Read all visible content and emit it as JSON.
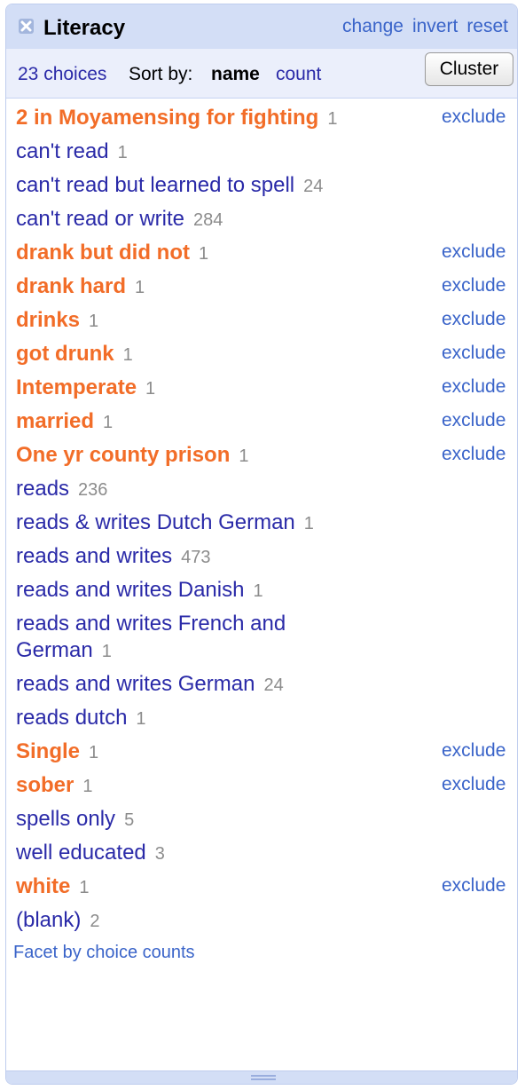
{
  "facet": {
    "title": "Literacy",
    "change": "change",
    "invert": "invert",
    "reset": "reset",
    "choice_count": "23 choices",
    "sort_by": "Sort by:",
    "sort_name": "name",
    "sort_count": "count",
    "cluster": "Cluster",
    "exclude": "exclude",
    "footer_link": "Facet by choice counts"
  },
  "choices": [
    {
      "label": "2 in Moyamensing for fighting",
      "count": "1",
      "selected": true
    },
    {
      "label": "can't read",
      "count": "1",
      "selected": false
    },
    {
      "label": "can't read but learned to spell",
      "count": "24",
      "selected": false
    },
    {
      "label": "can't read or write",
      "count": "284",
      "selected": false
    },
    {
      "label": "drank but did not",
      "count": "1",
      "selected": true
    },
    {
      "label": "drank hard",
      "count": "1",
      "selected": true
    },
    {
      "label": "drinks",
      "count": "1",
      "selected": true
    },
    {
      "label": "got drunk",
      "count": "1",
      "selected": true
    },
    {
      "label": "Intemperate",
      "count": "1",
      "selected": true
    },
    {
      "label": "married",
      "count": "1",
      "selected": true
    },
    {
      "label": "One yr county prison",
      "count": "1",
      "selected": true
    },
    {
      "label": "reads",
      "count": "236",
      "selected": false
    },
    {
      "label": "reads & writes Dutch German",
      "count": "1",
      "selected": false
    },
    {
      "label": "reads and writes",
      "count": "473",
      "selected": false
    },
    {
      "label": "reads and writes Danish",
      "count": "1",
      "selected": false
    },
    {
      "label": "reads and writes French and German",
      "count": "1",
      "selected": false
    },
    {
      "label": "reads and writes German",
      "count": "24",
      "selected": false
    },
    {
      "label": "reads dutch",
      "count": "1",
      "selected": false
    },
    {
      "label": "Single",
      "count": "1",
      "selected": true
    },
    {
      "label": "sober",
      "count": "1",
      "selected": true
    },
    {
      "label": "spells only",
      "count": "5",
      "selected": false
    },
    {
      "label": "well educated",
      "count": "3",
      "selected": false
    },
    {
      "label": "white",
      "count": "1",
      "selected": true
    },
    {
      "label": "(blank)",
      "count": "2",
      "selected": false
    }
  ]
}
